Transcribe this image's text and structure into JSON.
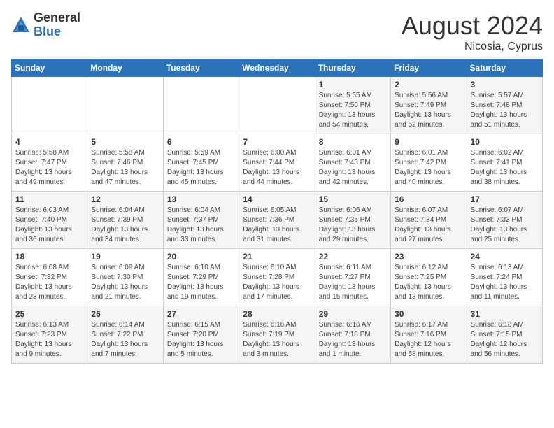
{
  "header": {
    "logo_general": "General",
    "logo_blue": "Blue",
    "month_year": "August 2024",
    "location": "Nicosia, Cyprus"
  },
  "weekdays": [
    "Sunday",
    "Monday",
    "Tuesday",
    "Wednesday",
    "Thursday",
    "Friday",
    "Saturday"
  ],
  "weeks": [
    [
      {
        "day": "",
        "text": ""
      },
      {
        "day": "",
        "text": ""
      },
      {
        "day": "",
        "text": ""
      },
      {
        "day": "",
        "text": ""
      },
      {
        "day": "1",
        "text": "Sunrise: 5:55 AM\nSunset: 7:50 PM\nDaylight: 13 hours\nand 54 minutes."
      },
      {
        "day": "2",
        "text": "Sunrise: 5:56 AM\nSunset: 7:49 PM\nDaylight: 13 hours\nand 52 minutes."
      },
      {
        "day": "3",
        "text": "Sunrise: 5:57 AM\nSunset: 7:48 PM\nDaylight: 13 hours\nand 51 minutes."
      }
    ],
    [
      {
        "day": "4",
        "text": "Sunrise: 5:58 AM\nSunset: 7:47 PM\nDaylight: 13 hours\nand 49 minutes."
      },
      {
        "day": "5",
        "text": "Sunrise: 5:58 AM\nSunset: 7:46 PM\nDaylight: 13 hours\nand 47 minutes."
      },
      {
        "day": "6",
        "text": "Sunrise: 5:59 AM\nSunset: 7:45 PM\nDaylight: 13 hours\nand 45 minutes."
      },
      {
        "day": "7",
        "text": "Sunrise: 6:00 AM\nSunset: 7:44 PM\nDaylight: 13 hours\nand 44 minutes."
      },
      {
        "day": "8",
        "text": "Sunrise: 6:01 AM\nSunset: 7:43 PM\nDaylight: 13 hours\nand 42 minutes."
      },
      {
        "day": "9",
        "text": "Sunrise: 6:01 AM\nSunset: 7:42 PM\nDaylight: 13 hours\nand 40 minutes."
      },
      {
        "day": "10",
        "text": "Sunrise: 6:02 AM\nSunset: 7:41 PM\nDaylight: 13 hours\nand 38 minutes."
      }
    ],
    [
      {
        "day": "11",
        "text": "Sunrise: 6:03 AM\nSunset: 7:40 PM\nDaylight: 13 hours\nand 36 minutes."
      },
      {
        "day": "12",
        "text": "Sunrise: 6:04 AM\nSunset: 7:39 PM\nDaylight: 13 hours\nand 34 minutes."
      },
      {
        "day": "13",
        "text": "Sunrise: 6:04 AM\nSunset: 7:37 PM\nDaylight: 13 hours\nand 33 minutes."
      },
      {
        "day": "14",
        "text": "Sunrise: 6:05 AM\nSunset: 7:36 PM\nDaylight: 13 hours\nand 31 minutes."
      },
      {
        "day": "15",
        "text": "Sunrise: 6:06 AM\nSunset: 7:35 PM\nDaylight: 13 hours\nand 29 minutes."
      },
      {
        "day": "16",
        "text": "Sunrise: 6:07 AM\nSunset: 7:34 PM\nDaylight: 13 hours\nand 27 minutes."
      },
      {
        "day": "17",
        "text": "Sunrise: 6:07 AM\nSunset: 7:33 PM\nDaylight: 13 hours\nand 25 minutes."
      }
    ],
    [
      {
        "day": "18",
        "text": "Sunrise: 6:08 AM\nSunset: 7:32 PM\nDaylight: 13 hours\nand 23 minutes."
      },
      {
        "day": "19",
        "text": "Sunrise: 6:09 AM\nSunset: 7:30 PM\nDaylight: 13 hours\nand 21 minutes."
      },
      {
        "day": "20",
        "text": "Sunrise: 6:10 AM\nSunset: 7:29 PM\nDaylight: 13 hours\nand 19 minutes."
      },
      {
        "day": "21",
        "text": "Sunrise: 6:10 AM\nSunset: 7:28 PM\nDaylight: 13 hours\nand 17 minutes."
      },
      {
        "day": "22",
        "text": "Sunrise: 6:11 AM\nSunset: 7:27 PM\nDaylight: 13 hours\nand 15 minutes."
      },
      {
        "day": "23",
        "text": "Sunrise: 6:12 AM\nSunset: 7:25 PM\nDaylight: 13 hours\nand 13 minutes."
      },
      {
        "day": "24",
        "text": "Sunrise: 6:13 AM\nSunset: 7:24 PM\nDaylight: 13 hours\nand 11 minutes."
      }
    ],
    [
      {
        "day": "25",
        "text": "Sunrise: 6:13 AM\nSunset: 7:23 PM\nDaylight: 13 hours\nand 9 minutes."
      },
      {
        "day": "26",
        "text": "Sunrise: 6:14 AM\nSunset: 7:22 PM\nDaylight: 13 hours\nand 7 minutes."
      },
      {
        "day": "27",
        "text": "Sunrise: 6:15 AM\nSunset: 7:20 PM\nDaylight: 13 hours\nand 5 minutes."
      },
      {
        "day": "28",
        "text": "Sunrise: 6:16 AM\nSunset: 7:19 PM\nDaylight: 13 hours\nand 3 minutes."
      },
      {
        "day": "29",
        "text": "Sunrise: 6:16 AM\nSunset: 7:18 PM\nDaylight: 13 hours\nand 1 minute."
      },
      {
        "day": "30",
        "text": "Sunrise: 6:17 AM\nSunset: 7:16 PM\nDaylight: 12 hours\nand 58 minutes."
      },
      {
        "day": "31",
        "text": "Sunrise: 6:18 AM\nSunset: 7:15 PM\nDaylight: 12 hours\nand 56 minutes."
      }
    ]
  ]
}
